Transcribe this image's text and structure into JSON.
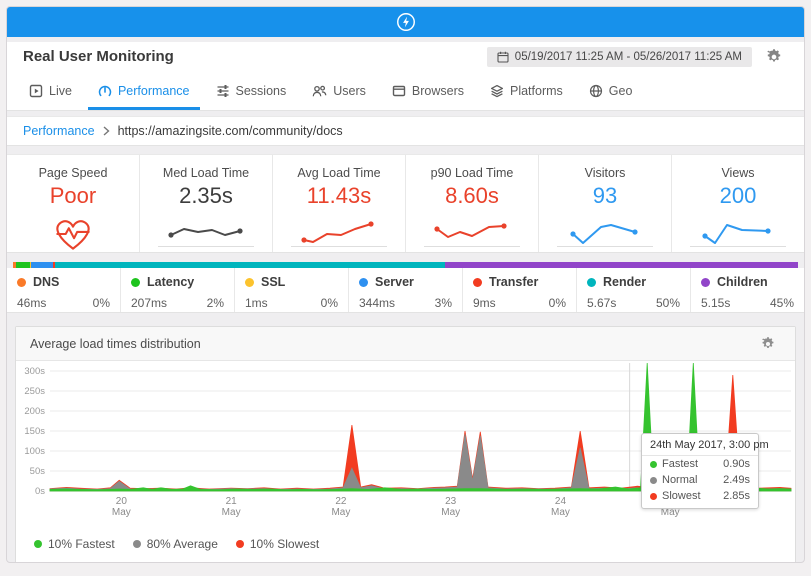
{
  "topbar": {
    "brand_icon": "lightning-icon",
    "color": "#1791eb"
  },
  "header": {
    "title": "Real User Monitoring",
    "date_range": "05/19/2017 11:25 AM - 05/26/2017 11:25 AM"
  },
  "tabs": [
    {
      "label": "Live",
      "icon": "live-icon",
      "active": false
    },
    {
      "label": "Performance",
      "icon": "performance-gauge-icon",
      "active": true
    },
    {
      "label": "Sessions",
      "icon": "sessions-icon",
      "active": false
    },
    {
      "label": "Users",
      "icon": "users-icon",
      "active": false
    },
    {
      "label": "Browsers",
      "icon": "browser-icon",
      "active": false
    },
    {
      "label": "Platforms",
      "icon": "platforms-icon",
      "active": false
    },
    {
      "label": "Geo",
      "icon": "globe-icon",
      "active": false
    }
  ],
  "breadcrumb": {
    "section": "Performance",
    "url": "https://amazingsite.com/community/docs"
  },
  "summary_cards": [
    {
      "label": "Page Speed",
      "value": "Poor",
      "color": "#e9422b",
      "visual": "heartbeat-icon"
    },
    {
      "label": "Med Load Time",
      "value": "2.35s",
      "color": "#3d3d3d",
      "spark_color": "#4a4a4a",
      "spark": [
        [
          3,
          14
        ],
        [
          16,
          8
        ],
        [
          30,
          11
        ],
        [
          44,
          9
        ],
        [
          57,
          14
        ],
        [
          72,
          10
        ]
      ]
    },
    {
      "label": "Avg Load Time",
      "value": "11.43s",
      "color": "#e9422b",
      "spark_color": "#e9422b",
      "spark": [
        [
          3,
          19
        ],
        [
          12,
          21
        ],
        [
          26,
          13
        ],
        [
          40,
          14
        ],
        [
          54,
          8
        ],
        [
          70,
          3
        ]
      ]
    },
    {
      "label": "p90 Load Time",
      "value": "8.60s",
      "color": "#e9422b",
      "spark_color": "#e9422b",
      "spark": [
        [
          3,
          8
        ],
        [
          14,
          16
        ],
        [
          26,
          11
        ],
        [
          38,
          15
        ],
        [
          55,
          6
        ],
        [
          70,
          5
        ]
      ]
    },
    {
      "label": "Visitors",
      "value": "93",
      "color": "#2f99f0",
      "spark_color": "#2f99f0",
      "spark": [
        [
          6,
          13
        ],
        [
          16,
          22
        ],
        [
          34,
          6
        ],
        [
          44,
          4
        ],
        [
          68,
          11
        ]
      ]
    },
    {
      "label": "Views",
      "value": "200",
      "color": "#2f99f0",
      "spark_color": "#2f99f0",
      "spark": [
        [
          5,
          15
        ],
        [
          15,
          22
        ],
        [
          27,
          4
        ],
        [
          42,
          9
        ],
        [
          68,
          10
        ]
      ]
    }
  ],
  "timing_breakdown": [
    {
      "label": "DNS",
      "value": "46ms",
      "percent": "0%",
      "color": "#fa7a28",
      "bar_fraction": 0.004
    },
    {
      "label": "Latency",
      "value": "207ms",
      "percent": "2%",
      "color": "#1ec41e",
      "bar_fraction": 0.018
    },
    {
      "label": "SSL",
      "value": "1ms",
      "percent": "0%",
      "color": "#fcc32d",
      "bar_fraction": 0.0015
    },
    {
      "label": "Server",
      "value": "344ms",
      "percent": "3%",
      "color": "#2e90f0",
      "bar_fraction": 0.028
    },
    {
      "label": "Transfer",
      "value": "9ms",
      "percent": "0%",
      "color": "#f23c21",
      "bar_fraction": 0.0025
    },
    {
      "label": "Render",
      "value": "5.67s",
      "percent": "50%",
      "color": "#00b5bd",
      "bar_fraction": 0.496
    },
    {
      "label": "Children",
      "value": "5.15s",
      "percent": "45%",
      "color": "#9145c9",
      "bar_fraction": 0.45
    }
  ],
  "chart_panel": {
    "title": "Average load times distribution"
  },
  "chart_data": {
    "type": "area",
    "title": "Average load times distribution",
    "ylim": [
      0,
      300
    ],
    "y_ticks": [
      "0s",
      "50s",
      "100s",
      "150s",
      "200s",
      "250s",
      "300s"
    ],
    "x_range": [
      19.35,
      26.1
    ],
    "x_ticks": [
      {
        "day": 20,
        "label": "20",
        "sub": "May"
      },
      {
        "day": 21,
        "label": "21",
        "sub": "May"
      },
      {
        "day": 22,
        "label": "22",
        "sub": "May"
      },
      {
        "day": 23,
        "label": "23",
        "sub": "May"
      },
      {
        "day": 24,
        "label": "24",
        "sub": "May"
      },
      {
        "day": 25,
        "label": "25",
        "sub": "May"
      }
    ],
    "hover_day": 24.63,
    "grid": true,
    "legend_position": "bottom",
    "series": [
      {
        "name": "10% Slowest",
        "color": "#f23c21",
        "points": [
          [
            19.35,
            6
          ],
          [
            19.5,
            9
          ],
          [
            19.62,
            7
          ],
          [
            19.78,
            5
          ],
          [
            19.9,
            8
          ],
          [
            19.98,
            27
          ],
          [
            20.08,
            7
          ],
          [
            20.2,
            6
          ],
          [
            20.36,
            7
          ],
          [
            20.5,
            5
          ],
          [
            20.63,
            8
          ],
          [
            20.8,
            5
          ],
          [
            21.0,
            7
          ],
          [
            21.15,
            6
          ],
          [
            21.3,
            8
          ],
          [
            21.45,
            5
          ],
          [
            21.6,
            7
          ],
          [
            21.75,
            5
          ],
          [
            21.9,
            7
          ],
          [
            22.02,
            10
          ],
          [
            22.1,
            165
          ],
          [
            22.18,
            10
          ],
          [
            22.28,
            16
          ],
          [
            22.4,
            7
          ],
          [
            22.55,
            8
          ],
          [
            22.7,
            6
          ],
          [
            22.85,
            9
          ],
          [
            22.95,
            10
          ],
          [
            23.06,
            12
          ],
          [
            23.13,
            150
          ],
          [
            23.2,
            30
          ],
          [
            23.27,
            148
          ],
          [
            23.34,
            10
          ],
          [
            23.5,
            7
          ],
          [
            23.65,
            8
          ],
          [
            23.8,
            6
          ],
          [
            23.95,
            7
          ],
          [
            24.1,
            10
          ],
          [
            24.18,
            150
          ],
          [
            24.26,
            8
          ],
          [
            24.4,
            10
          ],
          [
            24.55,
            7
          ],
          [
            24.7,
            12
          ],
          [
            24.79,
            9
          ],
          [
            24.9,
            7
          ],
          [
            25.05,
            8
          ],
          [
            25.21,
            8
          ],
          [
            25.35,
            8
          ],
          [
            25.5,
            9
          ],
          [
            25.57,
            290
          ],
          [
            25.64,
            8
          ],
          [
            25.8,
            7
          ],
          [
            26.0,
            9
          ],
          [
            26.1,
            7
          ]
        ]
      },
      {
        "name": "80% Average",
        "color": "#8a8a8a",
        "points": [
          [
            19.35,
            5
          ],
          [
            19.5,
            7
          ],
          [
            19.62,
            5
          ],
          [
            19.78,
            4
          ],
          [
            19.9,
            6
          ],
          [
            19.98,
            24
          ],
          [
            20.08,
            5
          ],
          [
            20.2,
            5
          ],
          [
            20.36,
            5
          ],
          [
            20.5,
            4
          ],
          [
            20.63,
            6
          ],
          [
            20.8,
            4
          ],
          [
            21.0,
            6
          ],
          [
            21.15,
            5
          ],
          [
            21.3,
            6
          ],
          [
            21.45,
            4
          ],
          [
            21.6,
            5
          ],
          [
            21.75,
            4
          ],
          [
            21.9,
            5
          ],
          [
            22.02,
            8
          ],
          [
            22.1,
            57
          ],
          [
            22.18,
            8
          ],
          [
            22.28,
            13
          ],
          [
            22.4,
            5
          ],
          [
            22.55,
            6
          ],
          [
            22.7,
            5
          ],
          [
            22.85,
            7
          ],
          [
            22.95,
            8
          ],
          [
            23.06,
            10
          ],
          [
            23.13,
            142
          ],
          [
            23.2,
            25
          ],
          [
            23.27,
            138
          ],
          [
            23.34,
            8
          ],
          [
            23.5,
            5
          ],
          [
            23.65,
            6
          ],
          [
            23.8,
            5
          ],
          [
            23.95,
            5
          ],
          [
            24.1,
            8
          ],
          [
            24.18,
            108
          ],
          [
            24.26,
            6
          ],
          [
            24.4,
            7
          ],
          [
            24.55,
            5
          ],
          [
            24.7,
            8
          ],
          [
            24.79,
            6
          ],
          [
            24.9,
            5
          ],
          [
            25.05,
            6
          ],
          [
            25.21,
            5
          ],
          [
            25.35,
            6
          ],
          [
            25.5,
            7
          ],
          [
            25.57,
            20
          ],
          [
            25.64,
            6
          ],
          [
            25.8,
            5
          ],
          [
            26.0,
            6
          ],
          [
            26.1,
            5
          ]
        ]
      },
      {
        "name": "10% Fastest",
        "color": "#35c32f",
        "points": [
          [
            19.35,
            4
          ],
          [
            19.5,
            5
          ],
          [
            19.62,
            4
          ],
          [
            19.78,
            3
          ],
          [
            19.9,
            4
          ],
          [
            19.98,
            5
          ],
          [
            20.08,
            4
          ],
          [
            20.2,
            8
          ],
          [
            20.28,
            4
          ],
          [
            20.36,
            8
          ],
          [
            20.46,
            4
          ],
          [
            20.56,
            5
          ],
          [
            20.63,
            13
          ],
          [
            20.72,
            4
          ],
          [
            20.9,
            3
          ],
          [
            21.05,
            5
          ],
          [
            21.2,
            4
          ],
          [
            21.35,
            5
          ],
          [
            21.5,
            3
          ],
          [
            21.65,
            4
          ],
          [
            21.8,
            3
          ],
          [
            21.95,
            4
          ],
          [
            22.1,
            6
          ],
          [
            22.25,
            4
          ],
          [
            22.4,
            8
          ],
          [
            22.55,
            4
          ],
          [
            22.7,
            5
          ],
          [
            22.85,
            4
          ],
          [
            23.0,
            5
          ],
          [
            23.13,
            6
          ],
          [
            23.28,
            6
          ],
          [
            23.4,
            5
          ],
          [
            23.55,
            4
          ],
          [
            23.7,
            5
          ],
          [
            23.85,
            4
          ],
          [
            24.0,
            5
          ],
          [
            24.18,
            6
          ],
          [
            24.35,
            5
          ],
          [
            24.5,
            10
          ],
          [
            24.62,
            5
          ],
          [
            24.73,
            8
          ],
          [
            24.79,
            325
          ],
          [
            24.85,
            5
          ],
          [
            25.0,
            5
          ],
          [
            25.08,
            6
          ],
          [
            25.15,
            6
          ],
          [
            25.21,
            325
          ],
          [
            25.27,
            5
          ],
          [
            25.4,
            6
          ],
          [
            25.5,
            8
          ],
          [
            25.64,
            5
          ],
          [
            25.78,
            7
          ],
          [
            25.9,
            5
          ],
          [
            26.0,
            6
          ],
          [
            26.1,
            5
          ]
        ]
      }
    ],
    "legend": [
      {
        "label": "10% Fastest",
        "color": "#35c32f"
      },
      {
        "label": "80% Average",
        "color": "#8a8a8a"
      },
      {
        "label": "10% Slowest",
        "color": "#f23c21"
      }
    ],
    "tooltip": {
      "title": "24th May 2017, 3:00 pm",
      "rows": [
        {
          "label": "Fastest",
          "value": "0.90s",
          "color": "#35c32f"
        },
        {
          "label": "Normal",
          "value": "2.49s",
          "color": "#8a8a8a"
        },
        {
          "label": "Slowest",
          "value": "2.85s",
          "color": "#f23c21"
        }
      ]
    }
  }
}
